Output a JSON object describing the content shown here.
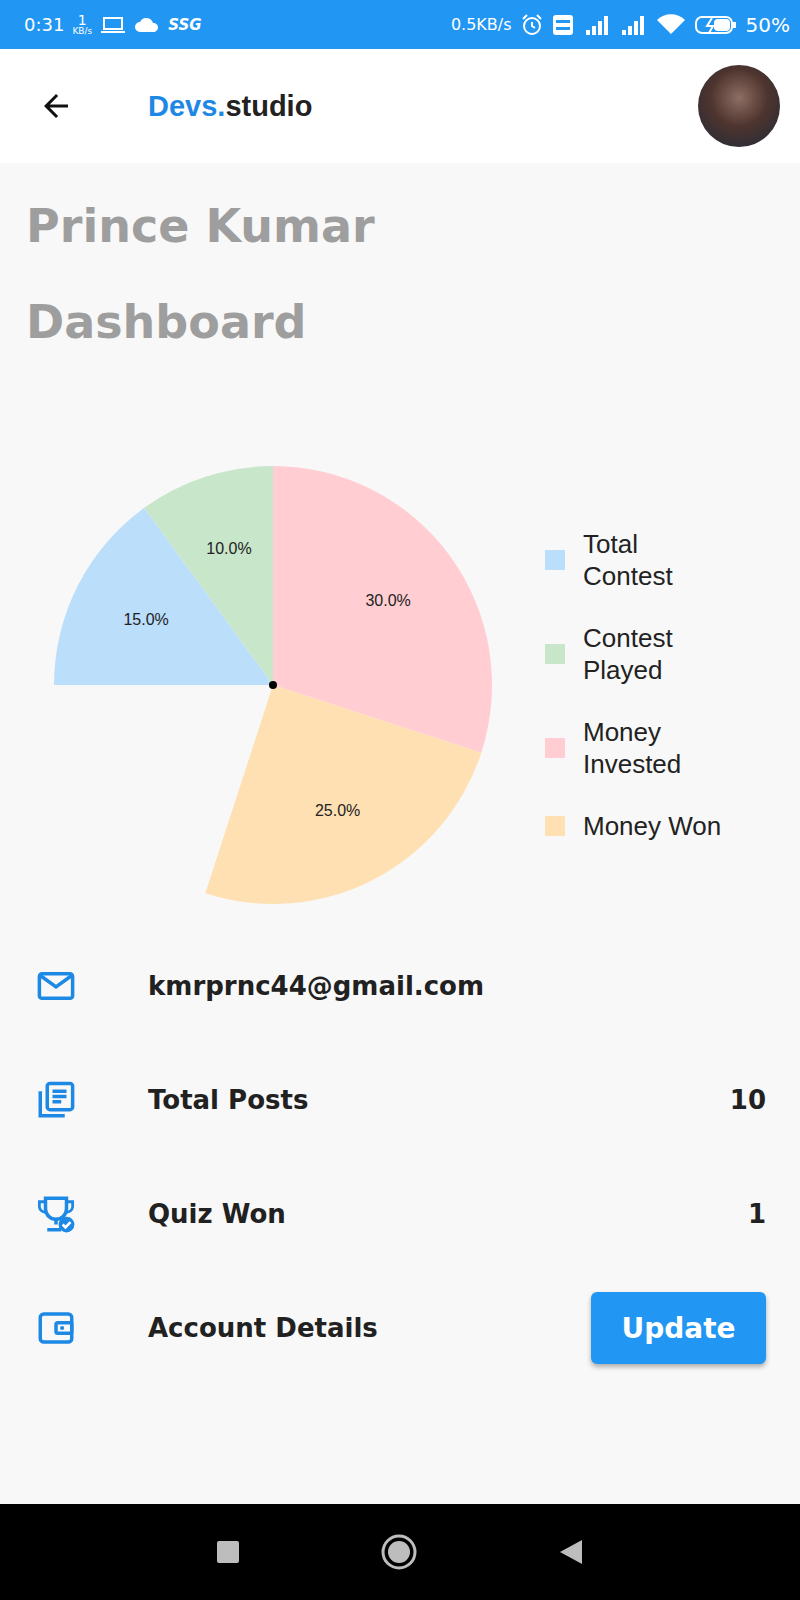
{
  "status_bar": {
    "time": "0:31",
    "speed_value": "1",
    "speed_unit": "KB/s",
    "carrier": "SSG",
    "net_speed": "0.5KB/s",
    "battery": "50%"
  },
  "app_bar": {
    "logo_prefix": "Devs.",
    "logo_suffix": "studio"
  },
  "profile": {
    "name": "Prince Kumar",
    "title": "Dashboard"
  },
  "chart": {
    "values": [
      15,
      10,
      30,
      25
    ],
    "labels": [
      "15.0%",
      "10.0%",
      "30.0%",
      "25.0%"
    ],
    "legend": [
      {
        "label": "Total Contest",
        "color": "#bbdefb"
      },
      {
        "label": "Contest Played",
        "color": "#c8e6c9"
      },
      {
        "label": "Money Invested",
        "color": "#ffcdd2"
      },
      {
        "label": "Money Won",
        "color": "#ffe0b2"
      }
    ]
  },
  "rows": [
    {
      "kind": "text",
      "label": "kmrprnc44@gmail.com"
    },
    {
      "kind": "value",
      "label": "Total Posts",
      "value": "10"
    },
    {
      "kind": "value",
      "label": "Quiz Won",
      "value": "1"
    },
    {
      "kind": "button",
      "label": "Account Details",
      "button": "Update"
    }
  ]
}
